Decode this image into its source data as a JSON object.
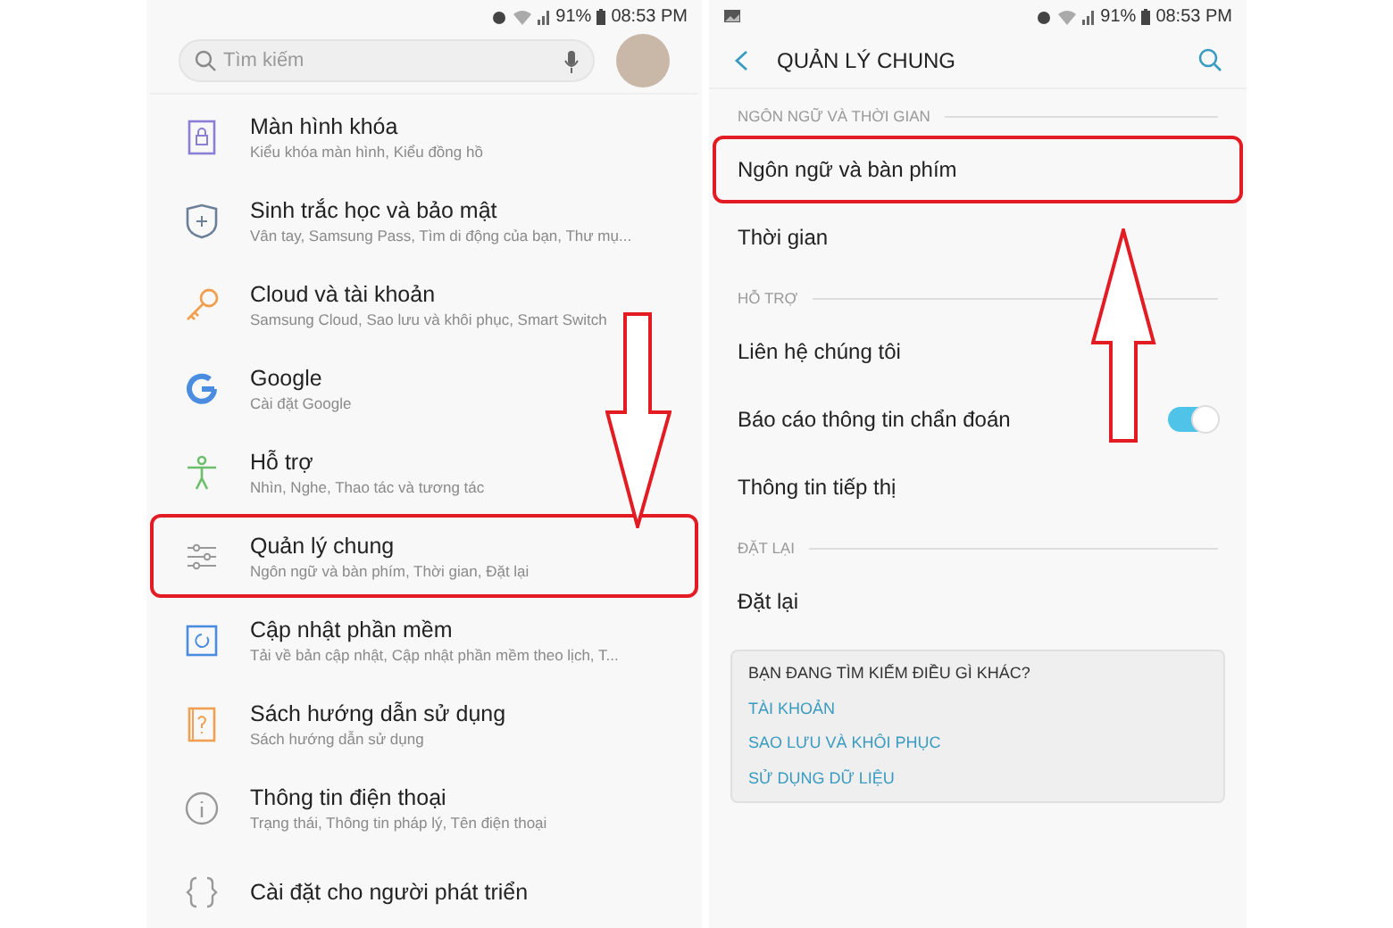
{
  "left_screen": {
    "status_bar": {
      "battery": "91%",
      "time": "08:53 PM"
    },
    "search": {
      "placeholder": "Tìm kiếm"
    },
    "arrow_annotation": true,
    "items": [
      {
        "title": "Màn hình khóa",
        "subtitle": "Kiểu khóa màn hình, Kiểu đồng hồ",
        "highlighted": false
      },
      {
        "title": "Sinh trắc học và bảo mật",
        "subtitle": "Vân tay, Samsung Pass, Tìm di động của bạn, Thư mụ...",
        "highlighted": false
      },
      {
        "title": "Cloud và tài khoản",
        "subtitle": "Samsung Cloud, Sao lưu và khôi phục, Smart Switch",
        "highlighted": false
      },
      {
        "title": "Google",
        "subtitle": "Cài đặt Google",
        "highlighted": false
      },
      {
        "title": "Hỗ trợ",
        "subtitle": "Nhìn, Nghe, Thao tác và tương tác",
        "highlighted": false
      },
      {
        "title": "Quản lý chung",
        "subtitle": "Ngôn ngữ và bàn phím, Thời gian, Đặt lại",
        "highlighted": true
      },
      {
        "title": "Cập nhật phần mềm",
        "subtitle": "Tải về bản cập nhật, Cập nhật phần mềm theo lịch, T...",
        "highlighted": false
      },
      {
        "title": "Sách hướng dẫn sử dụng",
        "subtitle": "Sách hướng dẫn sử dụng",
        "highlighted": false
      },
      {
        "title": "Thông tin điện thoại",
        "subtitle": "Trạng thái, Thông tin pháp lý, Tên điện thoại",
        "highlighted": false
      },
      {
        "title": "Cài đặt cho người phát triển",
        "highlighted": false
      }
    ]
  },
  "right_screen": {
    "status_bar": {
      "battery": "91%",
      "time": "08:53 PM"
    },
    "title": "QUẢN LÝ CHUNG",
    "arrow_annotation": true,
    "sections": [
      {
        "header": "NGÔN NGỮ VÀ THỜI GIAN",
        "items": [
          {
            "label": "Ngôn ngữ và bàn phím",
            "highlighted": true
          },
          {
            "label": "Thời gian",
            "highlighted": false
          }
        ]
      },
      {
        "header": "HỖ TRỢ",
        "items": [
          {
            "label": "Liên hệ chúng tôi",
            "highlighted": false
          },
          {
            "label": "Báo cáo thông tin chẩn đoán",
            "highlighted": false,
            "on": true
          },
          {
            "label": "Thông tin tiếp thị",
            "highlighted": false
          }
        ]
      },
      {
        "header": "ĐẶT LẠI",
        "items": [
          {
            "label": "Đặt lại",
            "highlighted": false
          }
        ]
      }
    ],
    "suggestions": {
      "title": "BẠN ĐANG TÌM KIẾM ĐIỀU GÌ KHÁC?",
      "links": [
        "TÀI KHOẢN",
        "SAO LƯU VÀ KHÔI PHỤC",
        "SỬ DỤNG DỮ LIỆU"
      ]
    }
  }
}
